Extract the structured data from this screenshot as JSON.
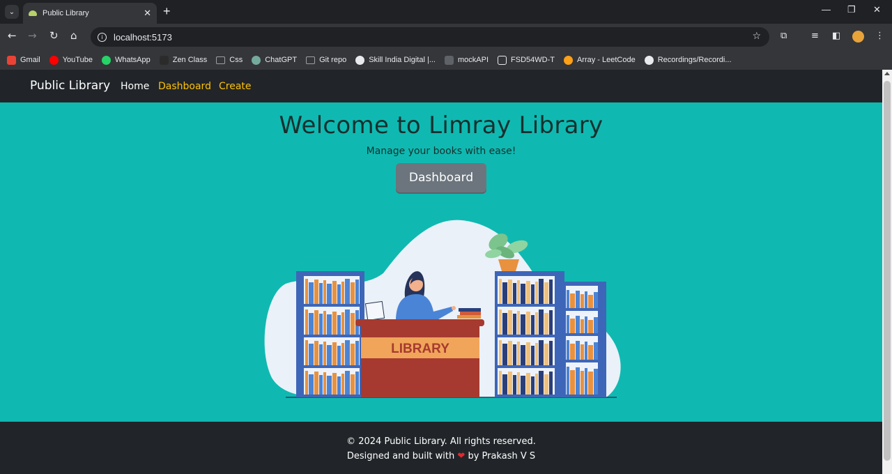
{
  "browser": {
    "tab_title": "Public Library",
    "url": "localhost:5173",
    "bookmarks": [
      {
        "label": "Gmail",
        "color": "#ea4335"
      },
      {
        "label": "YouTube",
        "color": "#ff0000"
      },
      {
        "label": "WhatsApp",
        "color": "#25d366"
      },
      {
        "label": "Zen Class",
        "color": "#2b2b2b"
      },
      {
        "label": "Css",
        "color": "#9aa0a6"
      },
      {
        "label": "ChatGPT",
        "color": "#74aa9c"
      },
      {
        "label": "Git repo",
        "color": "#9aa0a6"
      },
      {
        "label": "Skill India Digital |...",
        "color": "#e8eaed"
      },
      {
        "label": "mockAPI",
        "color": "#5f6368"
      },
      {
        "label": "FSD54WD-T",
        "color": "#e8eaed"
      },
      {
        "label": "Array - LeetCode",
        "color": "#ffa116"
      },
      {
        "label": "Recordings/Recordi...",
        "color": "#e8eaed"
      }
    ]
  },
  "navbar": {
    "brand": "Public Library",
    "links": [
      {
        "label": "Home",
        "color": "#ffffff"
      },
      {
        "label": "Dashboard",
        "color": "#ffc107"
      },
      {
        "label": "Create",
        "color": "#ffc107"
      }
    ]
  },
  "hero": {
    "title": "Welcome to Limray Library",
    "subtitle": "Manage your books with ease!",
    "button_label": "Dashboard",
    "illustration_sign": "LIBRARY"
  },
  "footer": {
    "copyright": "© 2024 Public Library. All rights reserved.",
    "credit_prefix": "Designed and built with",
    "heart": "❤",
    "credit_suffix": "by Prakash V S"
  },
  "colors": {
    "hero_bg": "#0fb9b1",
    "nav_bg": "#212529",
    "accent": "#ffc107",
    "button_bg": "#6c757d"
  }
}
